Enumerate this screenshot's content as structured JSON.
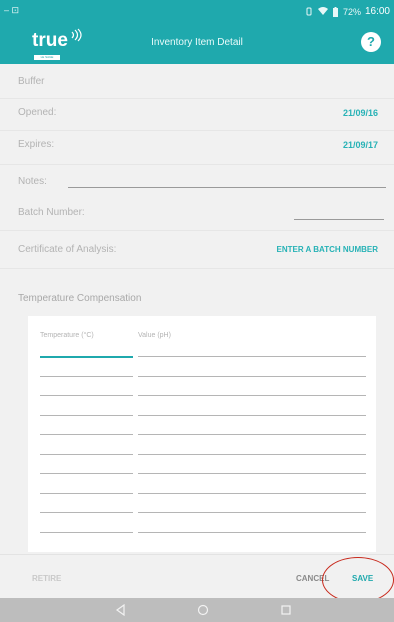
{
  "status_bar": {
    "time": "16:00",
    "battery": "72%"
  },
  "app_bar": {
    "logo_text": "true",
    "logo_subtext": "LE SAGE",
    "title": "Inventory Item Detail"
  },
  "item": {
    "name": "Buffer",
    "opened_label": "Opened:",
    "opened_value": "21/09/16",
    "expires_label": "Expires:",
    "expires_value": "21/09/17",
    "notes_label": "Notes:",
    "batch_label": "Batch Number:",
    "coa_label": "Certificate of Analysis:",
    "coa_action": "ENTER A BATCH NUMBER"
  },
  "temperature_compensation": {
    "title": "Temperature Compensation",
    "columns": [
      "Temperature (°C)",
      "Value (pH)"
    ],
    "rows": [
      [
        "",
        ""
      ],
      [
        "",
        ""
      ],
      [
        "",
        ""
      ],
      [
        "",
        ""
      ],
      [
        "",
        ""
      ],
      [
        "",
        ""
      ],
      [
        "",
        ""
      ],
      [
        "",
        ""
      ],
      [
        "",
        ""
      ],
      [
        "",
        ""
      ]
    ]
  },
  "actions": {
    "retire": "RETIRE",
    "cancel": "CANCEL",
    "save": "SAVE"
  },
  "colors": {
    "accent": "#1fa9ad",
    "link": "#27b2b6",
    "annotation": "#c8291c"
  },
  "icons": [
    "back-icon",
    "home-icon",
    "recents-icon",
    "help-icon",
    "wifi-icon",
    "battery-icon"
  ]
}
